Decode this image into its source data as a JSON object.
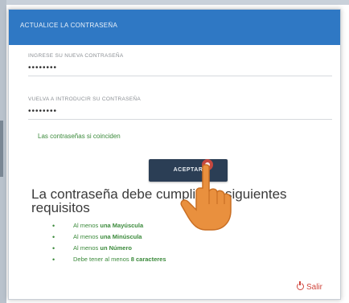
{
  "dialog": {
    "title": "ACTUALICE LA CONTRASEÑA",
    "new_password": {
      "label": "INGRESE SU NUEVA CONTRASEÑA",
      "value": "••••••••"
    },
    "confirm_password": {
      "label": "VUELVA A INTRODUCIR SU CONTRASEÑA",
      "value": "••••••••"
    },
    "match_message": "Las contraseñas si coinciden",
    "accept_label": "ACEPTAR",
    "requirements_heading": "La contraseña debe cumplir los siguientes requisitos",
    "requirements": [
      {
        "prefix": "Al menos ",
        "strong": "una Mayúscula",
        "suffix": ""
      },
      {
        "prefix": "Al menos ",
        "strong": "una Minúscula",
        "suffix": ""
      },
      {
        "prefix": "Al menos ",
        "strong": "un Número",
        "suffix": ""
      },
      {
        "prefix": "Debe tener al menos ",
        "strong": "8 caracteres",
        "suffix": ""
      }
    ],
    "bullet_char": "•",
    "exit_label": "Salir"
  },
  "colors": {
    "header": "#2f78c4",
    "accept_button": "#2b3e55",
    "success_text": "#3b8a3b",
    "exit": "#d0453c",
    "cursor": "#e9903e"
  },
  "icons": {
    "exit": "power-icon",
    "cursor": "hand-pointer-cursor"
  }
}
